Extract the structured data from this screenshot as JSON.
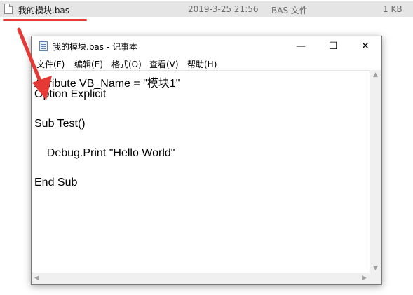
{
  "explorer": {
    "file_name": "我的模块.bas",
    "modified": "2019-3-25 21:56",
    "type": "BAS 文件",
    "size": "1 KB"
  },
  "notepad": {
    "title": "我的模块.bas - 记事本",
    "controls": {
      "minimize": "—",
      "maximize": "☐",
      "close": "✕"
    },
    "menu": [
      "文件(F)",
      "编辑(E)",
      "格式(O)",
      "查看(V)",
      "帮助(H)"
    ],
    "lines": [
      "Attribute VB_Name = \"模块1\"",
      "Option Explicit",
      "",
      "Sub Test()",
      "",
      "    Debug.Print \"Hello World\"",
      "",
      "End Sub"
    ]
  },
  "colors": {
    "annotation": "#e53935",
    "selection": "#e5e5e5"
  },
  "icons": [
    "file-icon",
    "notepad-icon",
    "red-arrow-annotation"
  ]
}
